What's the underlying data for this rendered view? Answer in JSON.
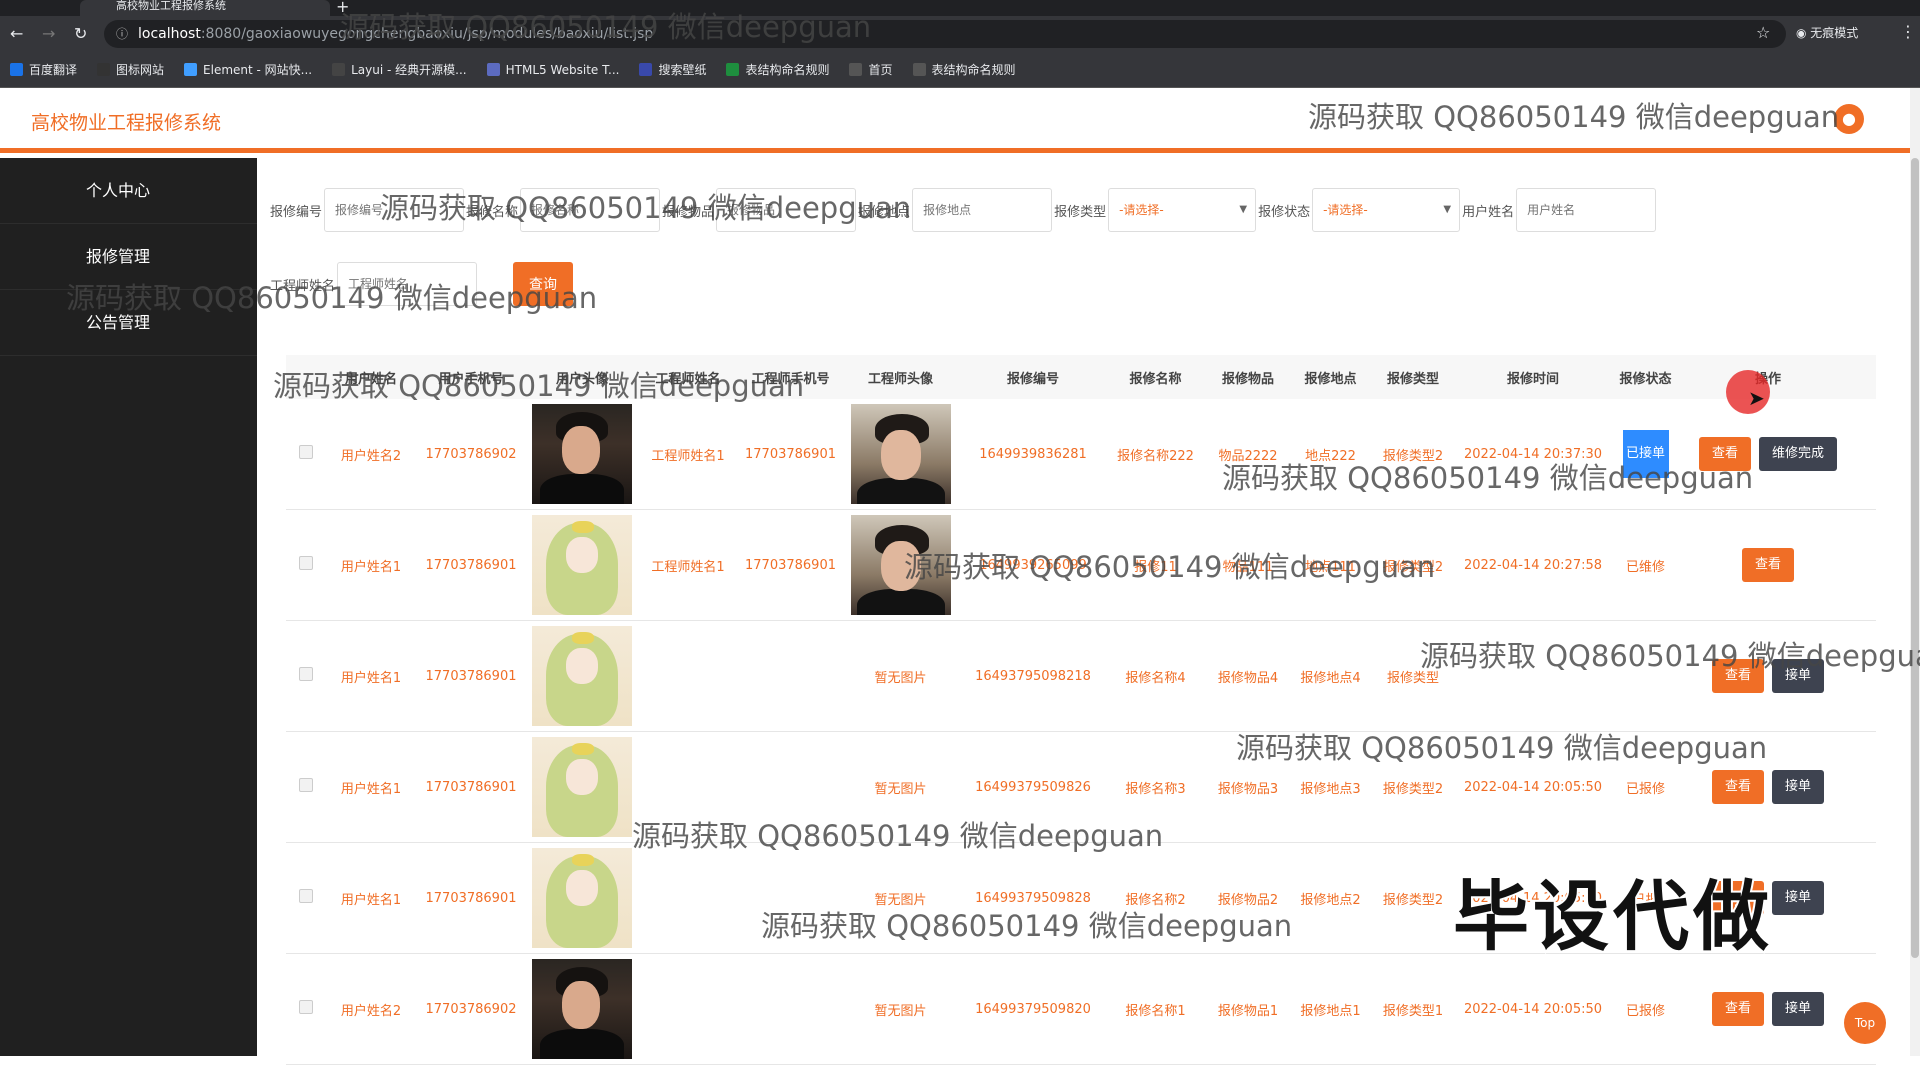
{
  "browser": {
    "tab_title": "高校物业工程报修系统",
    "url_host": "localhost",
    "url_path": ":8080/gaoxiaowuyegongchengbaoxiu/jsp/modules/baoxiu/list.jsp",
    "incognito_label": "无痕模式",
    "bookmarks": [
      "百度翻译",
      "图标网站",
      "Element - 网站快...",
      "Layui - 经典开源模...",
      "HTML5 Website T...",
      "搜索壁纸",
      "表结构命名规则",
      "首页",
      "表结构命名规则"
    ]
  },
  "app": {
    "title": "高校物业工程报修系统"
  },
  "sidebar": {
    "items": [
      "个人中心",
      "报修管理",
      "公告管理"
    ]
  },
  "search": {
    "fields": [
      {
        "label": "报修编号",
        "placeholder": "报修编号"
      },
      {
        "label": "报修名称",
        "placeholder": "报修名称"
      },
      {
        "label": "报修物品",
        "placeholder": "报修物品"
      },
      {
        "label": "报修地点",
        "placeholder": "报修地点"
      }
    ],
    "type_label": "报修类型",
    "type_value": "-请选择-",
    "status_label": "报修状态",
    "status_value": "-请选择-",
    "user_label": "用户姓名",
    "user_placeholder": "用户姓名",
    "engineer_label": "工程师姓名",
    "engineer_placeholder": "工程师姓名",
    "query_label": "查询"
  },
  "table": {
    "headers": [
      "用户姓名",
      "用户手机号",
      "用户头像",
      "工程师姓名",
      "工程师手机号",
      "工程师头像",
      "报修编号",
      "报修名称",
      "报修物品",
      "报修地点",
      "报修类型",
      "报修时间",
      "报修状态",
      "操作"
    ],
    "no_image": "暂无图片",
    "view_label": "查看",
    "rows": [
      {
        "user": "用户姓名2",
        "phone": "17703786902",
        "user_img": "man",
        "eng": "工程师姓名1",
        "eng_phone": "17703786901",
        "eng_img": "man2",
        "no": "1649939836281",
        "name": "报修名称222",
        "item": "物品2222",
        "place": "地点222",
        "type": "报修类型2",
        "time": "2022-04-14 20:37:30",
        "status": "已接单",
        "status_style": "blue",
        "action": "维修完成"
      },
      {
        "user": "用户姓名1",
        "phone": "17703786901",
        "user_img": "girl",
        "eng": "工程师姓名1",
        "eng_phone": "17703786901",
        "eng_img": "man2",
        "no": "1649939265099",
        "name": "报修11",
        "item": "物品111",
        "place": "地点111",
        "type": "报修类型2",
        "time": "2022-04-14 20:27:58",
        "status": "已维修",
        "status_style": "text",
        "action": ""
      },
      {
        "user": "用户姓名1",
        "phone": "17703786901",
        "user_img": "girl",
        "eng": "",
        "eng_phone": "",
        "eng_img": "",
        "no": "16493795098218",
        "name": "报修名称4",
        "item": "报修物品4",
        "place": "报修地点4",
        "type": "报修类型",
        "time": "",
        "status": "",
        "status_style": "text",
        "action": "接单"
      },
      {
        "user": "用户姓名1",
        "phone": "17703786901",
        "user_img": "girl",
        "eng": "",
        "eng_phone": "",
        "eng_img": "",
        "no": "16499379509826",
        "name": "报修名称3",
        "item": "报修物品3",
        "place": "报修地点3",
        "type": "报修类型2",
        "time": "2022-04-14 20:05:50",
        "status": "已报修",
        "status_style": "text",
        "action": "接单"
      },
      {
        "user": "用户姓名1",
        "phone": "17703786901",
        "user_img": "girl",
        "eng": "",
        "eng_phone": "",
        "eng_img": "",
        "no": "16499379509828",
        "name": "报修名称2",
        "item": "报修物品2",
        "place": "报修地点2",
        "type": "报修类型2",
        "time": "2022-04-14 20:05:50",
        "status": "已报",
        "status_style": "text",
        "action": "接单"
      },
      {
        "user": "用户姓名2",
        "phone": "17703786902",
        "user_img": "man",
        "eng": "",
        "eng_phone": "",
        "eng_img": "",
        "no": "16499379509820",
        "name": "报修名称1",
        "item": "报修物品1",
        "place": "报修地点1",
        "type": "报修类型1",
        "time": "2022-04-14 20:05:50",
        "status": "已报修",
        "status_style": "text",
        "action": "接单"
      }
    ]
  },
  "watermark": "源码获取 QQ86050149 微信deepguan",
  "overlay_text": "毕设代做",
  "top_label": "Top"
}
